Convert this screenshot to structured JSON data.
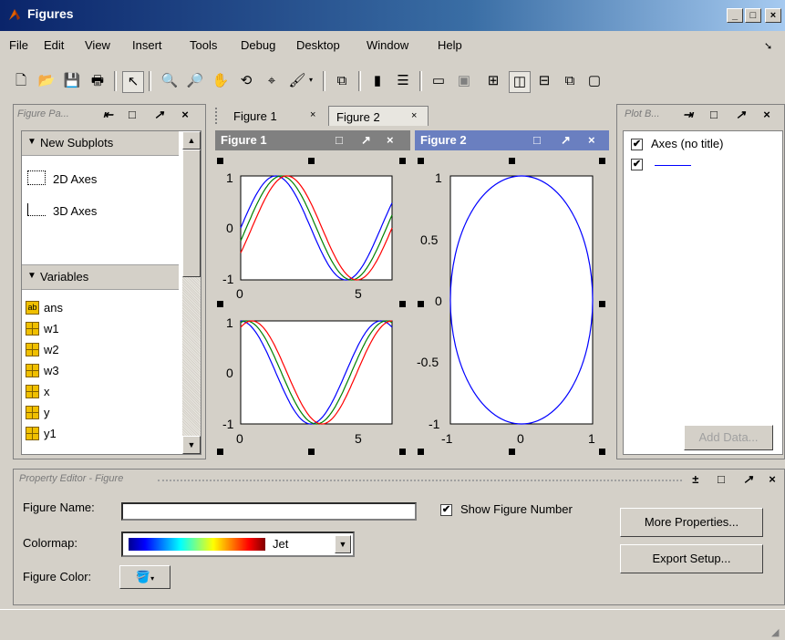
{
  "window": {
    "title": "Figures"
  },
  "menu": [
    "File",
    "Edit",
    "View",
    "Insert",
    "Tools",
    "Debug",
    "Desktop",
    "Window",
    "Help"
  ],
  "palette": {
    "header": "Figure Pa...",
    "subplots_label": "New Subplots",
    "axes2d": "2D Axes",
    "axes3d": "3D Axes",
    "variables_label": "Variables",
    "variables": [
      "ans",
      "w1",
      "w2",
      "w3",
      "x",
      "y",
      "y1"
    ]
  },
  "tabs": [
    "Figure 1",
    "Figure 2"
  ],
  "figure1": {
    "title": "Figure 1",
    "top_plot": {
      "xticks": [
        "0",
        "5"
      ],
      "yticks": [
        "1",
        "0",
        "-1"
      ]
    },
    "bottom_plot": {
      "xticks": [
        "0",
        "5"
      ],
      "yticks": [
        "1",
        "0",
        "-1"
      ]
    }
  },
  "figure2": {
    "title": "Figure 2",
    "xticks": [
      "-1",
      "0",
      "1"
    ],
    "yticks": [
      "1",
      "0.5",
      "0",
      "-0.5",
      "-1"
    ]
  },
  "plot_browser": {
    "header": "Plot B...",
    "axes_label": "Axes (no title)",
    "add_data": "Add Data..."
  },
  "property_editor": {
    "header": "Property Editor - Figure",
    "figure_name_label": "Figure Name:",
    "figure_name_value": "",
    "show_number_label": "Show Figure Number",
    "colormap_label": "Colormap:",
    "colormap_value": "Jet",
    "figure_color_label": "Figure Color:",
    "more_properties": "More Properties...",
    "export_setup": "Export Setup..."
  },
  "colors": {
    "sine1": "#0000ff",
    "sine2": "#008000",
    "sine3": "#ff0000",
    "ellipse": "#0000ff"
  }
}
